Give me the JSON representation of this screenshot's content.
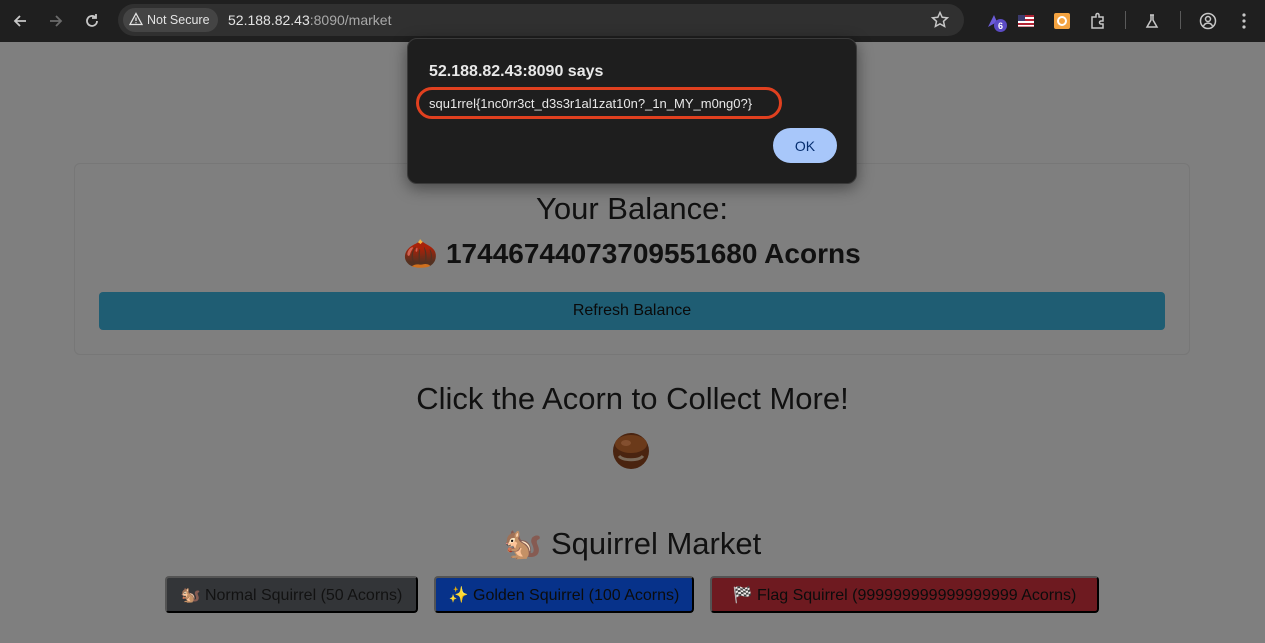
{
  "browser": {
    "security_label": "Not Secure",
    "url_host": "52.188.82.43",
    "url_rest": ":8090/market",
    "extension_badge": "6"
  },
  "balance": {
    "title": "Your Balance:",
    "amount": "🌰 17446744073709551680 Acorns",
    "refresh_label": "Refresh Balance"
  },
  "collect": {
    "title": "Click the Acorn to Collect More!",
    "acorn": "🌰"
  },
  "market": {
    "title": "🐿️ Squirrel Market",
    "normal_label": "🐿️ Normal Squirrel (50 Acorns)",
    "golden_label": "✨ Golden Squirrel (100 Acorns)",
    "flag_label": "🏁 Flag Squirrel (999999999999999999 Acorns)"
  },
  "dialog": {
    "title": "52.188.82.43:8090 says",
    "message": "squ1rrel{1nc0rr3ct_d3s3r1al1zat10n?_1n_MY_m0ng0?}",
    "ok_label": "OK"
  },
  "colors": {
    "highlight": "#e0401f",
    "ok_button": "#a8c7fa"
  }
}
